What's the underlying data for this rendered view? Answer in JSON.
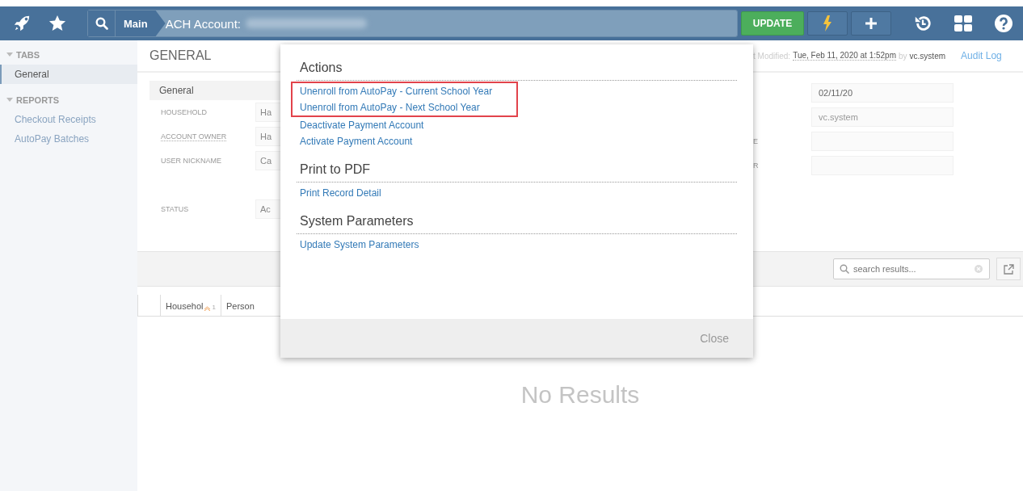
{
  "top_bar": {
    "breadcrumb": "Main",
    "record_title": "ACH Account:",
    "update_button": "UPDATE"
  },
  "sidebar": {
    "sections": [
      {
        "title": "TABS",
        "expanded": true,
        "items": [
          {
            "label": "General",
            "selected": true
          }
        ]
      },
      {
        "title": "REPORTS",
        "expanded": true,
        "items": [
          {
            "label": "Checkout Receipts",
            "selected": false
          },
          {
            "label": "AutoPay Batches",
            "selected": false
          }
        ]
      }
    ]
  },
  "main": {
    "section_title": "GENERAL",
    "modified": {
      "label": "t Modified:",
      "date": "Tue, Feb 11, 2020 at 1:52pm",
      "by": "by",
      "user": "vc.system"
    },
    "audit_link": "Audit Log",
    "card": {
      "title": "General",
      "fields": [
        {
          "label": "HOUSEHOLD",
          "value": "Ha",
          "underlined": false
        },
        {
          "label": "ACCOUNT OWNER",
          "value": "Ha",
          "underlined": true
        },
        {
          "label": "USER NICKNAME",
          "value": "Ca",
          "underlined": false
        },
        {
          "label": "STATUS",
          "value": "Ac",
          "underlined": false
        }
      ]
    },
    "right_fields": [
      {
        "value": "02/11/20",
        "disabled": false
      },
      {
        "value": "vc.system",
        "disabled": true
      },
      {
        "label": "E"
      },
      {
        "label": "R"
      }
    ],
    "search": {
      "placeholder": "search results..."
    },
    "table": {
      "columns": [
        {
          "label": "Househol",
          "sort_index": "1"
        },
        {
          "label": "Person"
        }
      ],
      "empty_message": "No Results"
    }
  },
  "modal": {
    "sections": [
      {
        "title": "Actions",
        "links": [
          {
            "label": "Unenroll from AutoPay - Current School Year",
            "highlighted": true
          },
          {
            "label": "Unenroll from AutoPay - Next School Year",
            "highlighted": true
          },
          {
            "label": "Deactivate Payment Account",
            "highlighted": false
          },
          {
            "label": "Activate Payment Account",
            "highlighted": false
          }
        ]
      },
      {
        "title": "Print to PDF",
        "links": [
          {
            "label": "Print Record Detail",
            "highlighted": false
          }
        ]
      },
      {
        "title": "System Parameters",
        "links": [
          {
            "label": "Update System Parameters",
            "highlighted": false
          }
        ]
      }
    ],
    "close": "Close"
  }
}
